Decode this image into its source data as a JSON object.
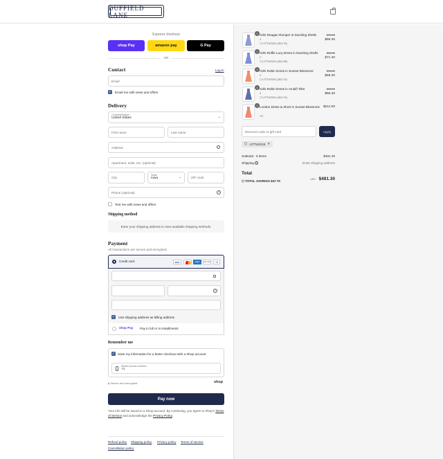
{
  "brand": {
    "name": "DUFFIELD LANE"
  },
  "express": {
    "title": "Express checkout",
    "shop_pay": "shop Pay",
    "amazon_pay": "amazon pay",
    "google_pay": "G Pay",
    "or": "OR"
  },
  "contact": {
    "heading": "Contact",
    "login": "Log in",
    "email_placeholder": "Email",
    "newsletter_label": "Email me with news and offers"
  },
  "delivery": {
    "heading": "Delivery",
    "country_label": "Country/Region",
    "country_value": "United States",
    "first_name": "First name",
    "last_name": "Last name",
    "address": "Address",
    "apartment": "Apartment, suite, etc. (optional)",
    "city": "City",
    "state_label": "State",
    "state_value": "Iowa",
    "zip": "ZIP code",
    "phone": "Phone (optional)",
    "text_offers": "Text me with news and offers"
  },
  "shipping": {
    "heading": "Shipping method",
    "notice": "Enter your shipping address to view available shipping methods."
  },
  "payment": {
    "heading": "Payment",
    "subtitle": "All transactions are secure and encrypted.",
    "credit_card": "Credit card",
    "card_brands": [
      "VISA",
      "MC",
      "AMEX",
      "DISCOVER",
      "+3"
    ],
    "billing_label": "Use shipping address as billing address",
    "shop_pay_label": "Pay in full or in installments",
    "shop_pay_badge": "shop Pay"
  },
  "remember": {
    "heading": "Remember me",
    "save_label": "Save my information for a faster checkout with a Shop account",
    "mobile_label": "Mobile phone number",
    "mobile_value": "+1",
    "secure": "Secure and encrypted",
    "shop_logo": "shop"
  },
  "pay_button": "Pay now",
  "legal": {
    "text_1": "Your info will be saved to a Shop account. By continuing, you agree to Shop's",
    "terms": "Terms of Service",
    "text_2": "and acknowledge the",
    "privacy": "Privacy Policy",
    "text_3": "."
  },
  "footer": [
    "Refund policy",
    "Shipping policy",
    "Privacy policy",
    "Terms of service",
    "Cancellation policy"
  ],
  "cart": {
    "items": [
      {
        "name": "Girls Reagan Romper in Dazzling Shells",
        "variant": "3",
        "discount": "LITTLES15 (-$11.70)",
        "original": "$78.00",
        "price": "$66.30",
        "qty": "1",
        "color": "#8d9ad4"
      },
      {
        "name": "Girls Ruffle Lucy Dress in Dazzling Shells",
        "variant": "2",
        "discount": "LITTLES15 (-$12.60)",
        "original": "$84.00",
        "price": "$71.40",
        "qty": "1",
        "color": "#7e8fd6"
      },
      {
        "name": "Girls Robin Dress in Sunset Blossoms",
        "variant": "3",
        "discount": "LITTLES15 (-$11.70)",
        "original": "$78.00",
        "price": "$66.30",
        "qty": "1",
        "color": "#f08e6a"
      },
      {
        "name": "Girls Robin Dress in Amalfi Tiles",
        "variant": "3",
        "discount": "LITTLES15 (-$11.70)",
        "original": "$78.00",
        "price": "$66.30",
        "qty": "1",
        "color": "#5f6fa9"
      },
      {
        "name": "London Dress & Short in Sunset Blossoms",
        "variant": "XS",
        "discount": "",
        "original": "",
        "price": "$211.00",
        "qty": "1",
        "color": "#f2866f"
      }
    ],
    "discount_placeholder": "Discount code or gift card",
    "apply": "Apply",
    "applied_code": "LITTLES15",
    "subtotal_label": "Subtotal · 5 items",
    "subtotal": "$481.30",
    "shipping_label": "Shipping",
    "shipping_value": "Enter shipping address",
    "total_label": "Total",
    "currency": "USD",
    "total": "$481.30",
    "savings_label": "TOTAL SAVINGS",
    "savings": "$47.70"
  }
}
